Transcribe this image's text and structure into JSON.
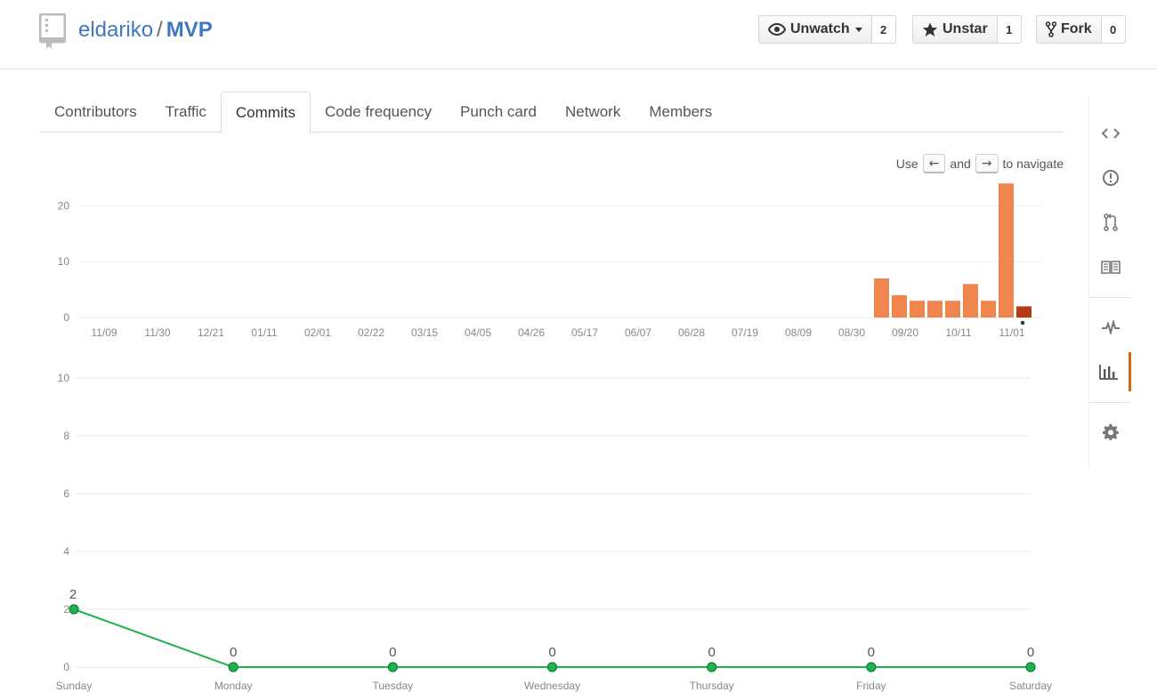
{
  "repo": {
    "owner": "eldariko",
    "separator": "/",
    "name": "MVP"
  },
  "actions": {
    "watch": {
      "label": "Unwatch",
      "count": "2"
    },
    "star": {
      "label": "Unstar",
      "count": "1"
    },
    "fork": {
      "label": "Fork",
      "count": "0"
    }
  },
  "tabs": [
    {
      "label": "Contributors"
    },
    {
      "label": "Traffic"
    },
    {
      "label": "Commits",
      "selected": true
    },
    {
      "label": "Code frequency"
    },
    {
      "label": "Punch card"
    },
    {
      "label": "Network"
    },
    {
      "label": "Members"
    }
  ],
  "navigate_hint": {
    "prefix": "Use",
    "left_key": "←",
    "and": "and",
    "right_key": "→",
    "suffix": "to navigate"
  },
  "sidebar": {
    "items": [
      {
        "icon": "code-icon",
        "label": "Code"
      },
      {
        "icon": "issue-icon",
        "label": "Issues"
      },
      {
        "icon": "pull-request-icon",
        "label": "Pull requests"
      },
      {
        "icon": "wiki-icon",
        "label": "Wiki"
      },
      {
        "icon": "pulse-icon",
        "label": "Pulse"
      },
      {
        "icon": "graph-icon",
        "label": "Graphs",
        "selected": true
      },
      {
        "icon": "gear-icon",
        "label": "Settings"
      }
    ]
  },
  "colors": {
    "accent": "#d26911",
    "link": "#4078c0",
    "bar": "#f1854e",
    "bar_selected": "#b33c13",
    "line": "#1db34f"
  },
  "chart_data": [
    {
      "type": "bar",
      "x_tick_labels": [
        "11/09",
        "11/30",
        "12/21",
        "01/11",
        "02/01",
        "02/22",
        "03/15",
        "04/05",
        "04/26",
        "05/17",
        "06/07",
        "06/28",
        "07/19",
        "08/09",
        "08/30",
        "09/20",
        "10/11",
        "11/01"
      ],
      "ylim": [
        0,
        25
      ],
      "y_ticks": [
        0,
        10,
        20
      ],
      "grid": true,
      "bars": [
        {
          "week_index": 0,
          "value": 0
        },
        {
          "week_index": 1,
          "value": 0
        },
        {
          "week_index": 2,
          "value": 0
        },
        {
          "week_index": 3,
          "value": 0
        },
        {
          "week_index": 4,
          "value": 0
        },
        {
          "week_index": 5,
          "value": 0
        },
        {
          "week_index": 6,
          "value": 0
        },
        {
          "week_index": 7,
          "value": 0
        },
        {
          "week_index": 8,
          "value": 0
        },
        {
          "week_index": 9,
          "value": 0
        },
        {
          "week_index": 10,
          "value": 0
        },
        {
          "week_index": 11,
          "value": 0
        },
        {
          "week_index": 12,
          "value": 0
        },
        {
          "week_index": 13,
          "value": 0
        },
        {
          "week_index": 14,
          "value": 0
        },
        {
          "week_index": 15,
          "value": 0
        },
        {
          "week_index": 16,
          "value": 0
        },
        {
          "week_index": 17,
          "value": 0
        },
        {
          "week_index": 18,
          "value": 0
        },
        {
          "week_index": 19,
          "value": 0
        },
        {
          "week_index": 20,
          "value": 0
        },
        {
          "week_index": 21,
          "value": 0
        },
        {
          "week_index": 22,
          "value": 0
        },
        {
          "week_index": 23,
          "value": 0
        },
        {
          "week_index": 24,
          "value": 0
        },
        {
          "week_index": 25,
          "value": 0
        },
        {
          "week_index": 26,
          "value": 0
        },
        {
          "week_index": 27,
          "value": 0
        },
        {
          "week_index": 28,
          "value": 0
        },
        {
          "week_index": 29,
          "value": 0
        },
        {
          "week_index": 30,
          "value": 0
        },
        {
          "week_index": 31,
          "value": 0
        },
        {
          "week_index": 32,
          "value": 0
        },
        {
          "week_index": 33,
          "value": 0
        },
        {
          "week_index": 34,
          "value": 0
        },
        {
          "week_index": 35,
          "value": 0
        },
        {
          "week_index": 36,
          "value": 0
        },
        {
          "week_index": 37,
          "value": 0
        },
        {
          "week_index": 38,
          "value": 0
        },
        {
          "week_index": 39,
          "value": 0
        },
        {
          "week_index": 40,
          "value": 0
        },
        {
          "week_index": 41,
          "value": 0
        },
        {
          "week_index": 42,
          "value": 0
        },
        {
          "week_index": 43,
          "value": 0
        },
        {
          "week_index": 44,
          "value": 7
        },
        {
          "week_index": 45,
          "value": 4
        },
        {
          "week_index": 46,
          "value": 3
        },
        {
          "week_index": 47,
          "value": 3
        },
        {
          "week_index": 48,
          "value": 3
        },
        {
          "week_index": 49,
          "value": 6
        },
        {
          "week_index": 50,
          "value": 3
        },
        {
          "week_index": 51,
          "value": 24
        },
        {
          "week_index": 52,
          "value": 2,
          "selected": true
        }
      ]
    },
    {
      "type": "line",
      "categories": [
        "Sunday",
        "Monday",
        "Tuesday",
        "Wednesday",
        "Thursday",
        "Friday",
        "Saturday"
      ],
      "values": [
        2,
        0,
        0,
        0,
        0,
        0,
        0
      ],
      "ylim": [
        0,
        10
      ],
      "y_ticks": [
        0,
        2,
        4,
        6,
        8,
        10
      ],
      "grid": true,
      "data_labels": [
        "2",
        "0",
        "0",
        "0",
        "0",
        "0",
        "0"
      ]
    }
  ]
}
